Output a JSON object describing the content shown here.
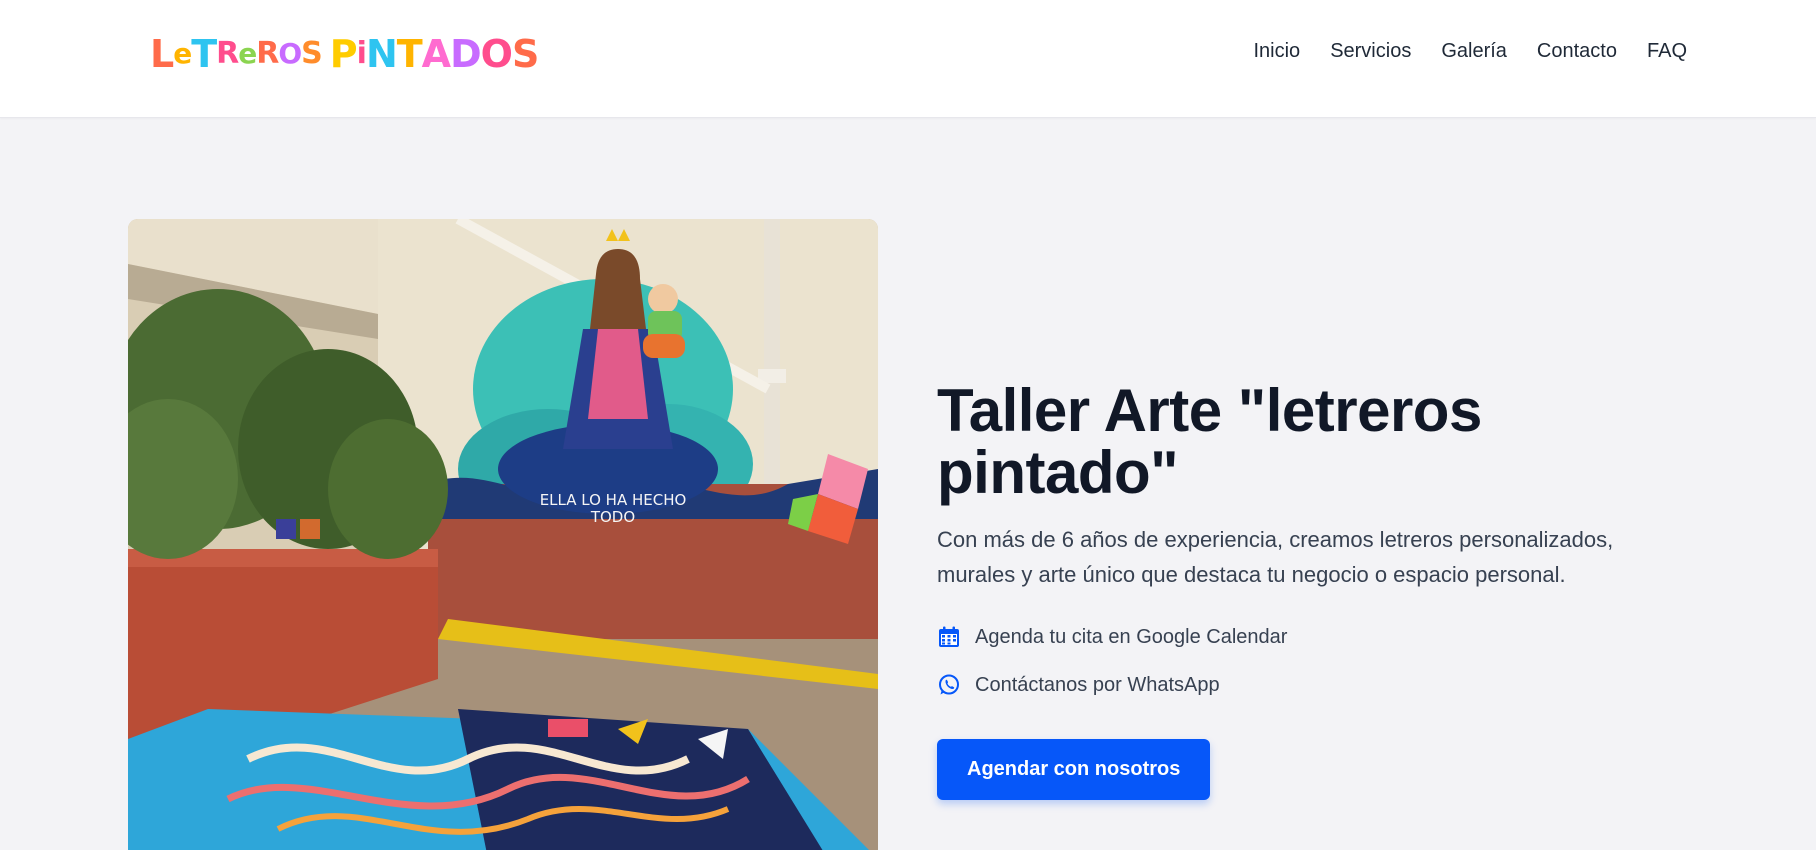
{
  "header": {
    "logo_text": "LeTReROS PiNTADOS",
    "nav": [
      "Inicio",
      "Servicios",
      "Galería",
      "Contacto",
      "FAQ"
    ]
  },
  "hero": {
    "image_caption": "ELLA LO HA HECHO TODO",
    "title": "Taller Arte \"letreros pintado\"",
    "subtitle": "Con más de 6 años de experiencia, creamos letreros personalizados, murales y arte único que destaca tu negocio o espacio personal.",
    "features": [
      {
        "icon": "calendar-icon",
        "text": "Agenda tu cita en Google Calendar"
      },
      {
        "icon": "whatsapp-icon",
        "text": "Contáctanos por WhatsApp"
      }
    ],
    "cta_label": "Agendar con nosotros"
  },
  "colors": {
    "primary": "#0657f9",
    "background": "#f3f3f6",
    "heading": "#111827",
    "body_text": "#374151"
  }
}
